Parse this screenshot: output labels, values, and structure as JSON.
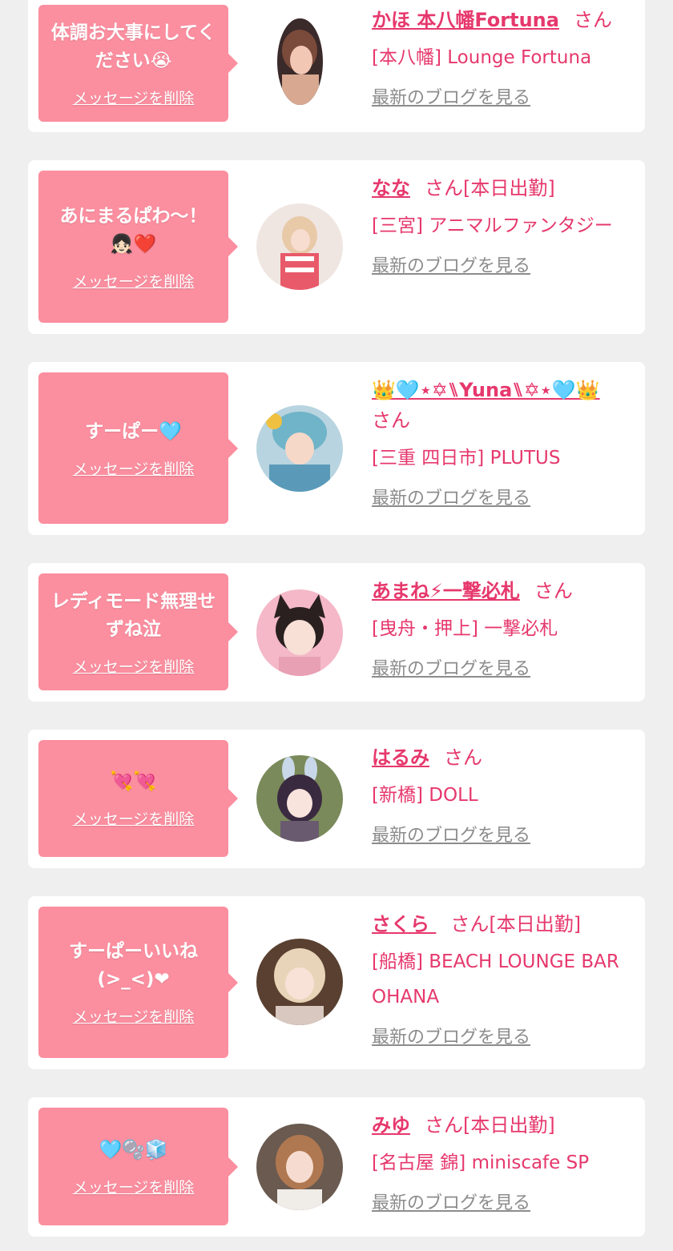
{
  "colors": {
    "background": "#efefef",
    "card": "#ffffff",
    "bubble": "#fb8e9f",
    "accent_pink": "#e6386c",
    "link_gray": "#8c8c8c"
  },
  "cards": [
    {
      "message": "体調お大事にしてください😭",
      "delete_label": "メッセージを削除",
      "name": "かほ 本八幡Fortuna",
      "suffix": "さん",
      "shop": "[本八幡] Lounge Fortuna",
      "blog_label": "最新のブログを見る"
    },
    {
      "message": "あにまるぱわ〜！👧🏻❤️",
      "delete_label": "メッセージを削除",
      "name": "なな",
      "suffix": "さん[本日出勤]",
      "shop": "[三宮] アニマルファンタジー",
      "blog_label": "最新のブログを見る"
    },
    {
      "message": "すーぱー🩵",
      "delete_label": "メッセージを削除",
      "name": "👑🩵⋆✡︎⑊Yuna⑊✡︎⋆🩵👑",
      "suffix": "さん",
      "shop": "[三重 四日市] PLUTUS",
      "blog_label": "最新のブログを見る"
    },
    {
      "message": "レディモード無理せずね泣",
      "delete_label": "メッセージを削除",
      "name": "あまね⚡一撃必札",
      "suffix": "さん",
      "shop": "[曳舟・押上] 一撃必札",
      "blog_label": "最新のブログを見る"
    },
    {
      "message": "💘💘",
      "delete_label": "メッセージを削除",
      "name": "はるみ",
      "suffix": "さん",
      "shop": "[新橋] DOLL",
      "blog_label": "最新のブログを見る"
    },
    {
      "message": "すーぱーいいね(>_<)❤",
      "delete_label": "メッセージを削除",
      "name": "さくら ",
      "suffix": "さん[本日出勤]",
      "shop": "[船橋] BEACH LOUNGE BAR OHANA",
      "blog_label": "最新のブログを見る"
    },
    {
      "message": "🩵🫧🧊",
      "delete_label": "メッセージを削除",
      "name": "みゆ",
      "suffix": "さん[本日出勤]",
      "shop": "[名古屋 錦] miniscafe SP",
      "blog_label": "最新のブログを見る"
    }
  ]
}
